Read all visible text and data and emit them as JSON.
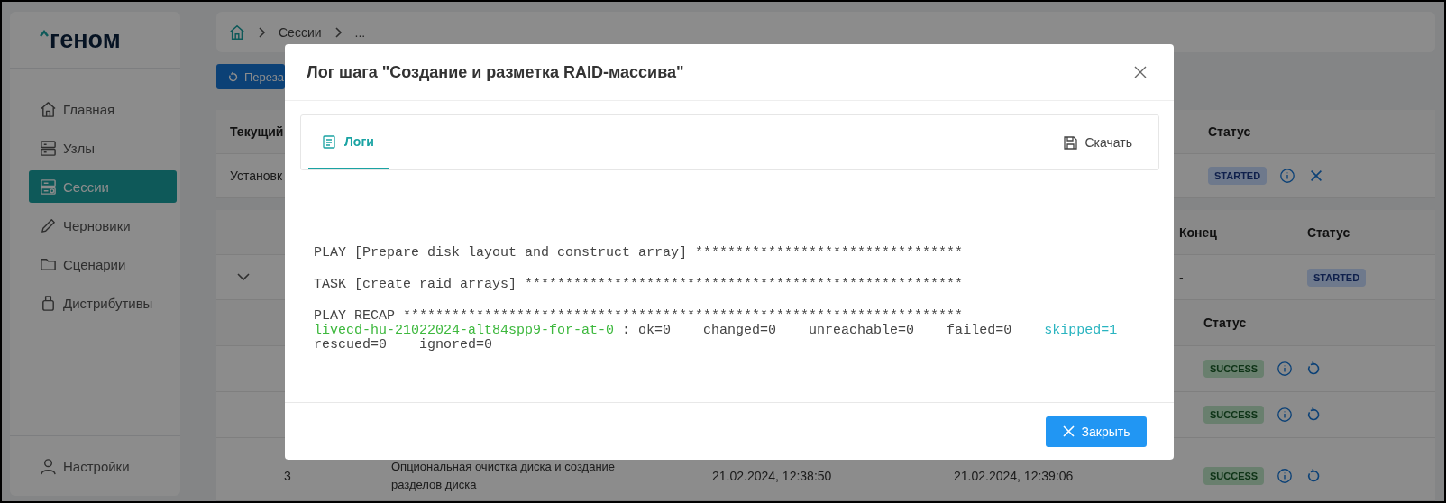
{
  "sidebar": {
    "logo": "геном",
    "items": [
      {
        "label": "Главная",
        "selected": false
      },
      {
        "label": "Узлы",
        "selected": false
      },
      {
        "label": "Сессии",
        "selected": true
      },
      {
        "label": "Черновики",
        "selected": false
      },
      {
        "label": "Сценарии",
        "selected": false
      },
      {
        "label": "Дистрибутивы",
        "selected": false
      }
    ],
    "settings": "Настройки"
  },
  "breadcrumb": [
    "Сессии",
    "..."
  ],
  "restart_button": "Переза",
  "current_table": {
    "columns": [
      "Текущий",
      "Статус"
    ],
    "row": {
      "name": "Установк",
      "status": {
        "label": "STARTED",
        "kind": "started"
      },
      "has_actions": true
    }
  },
  "steps_table": {
    "columns": [
      "Конец",
      "Статус"
    ],
    "row": {
      "end": "-",
      "status": {
        "label": "STARTED",
        "kind": "started"
      },
      "has_actions": false
    },
    "substeps": {
      "columns": [
        "Статус"
      ],
      "rows": [
        {
          "status": {
            "label": "SUCCESS",
            "kind": "success"
          },
          "has_actions": true
        },
        {
          "status": {
            "label": "SUCCESS",
            "kind": "success"
          },
          "has_actions": true
        },
        {
          "number": "3",
          "name": "Опциональная очистка диска и создание разделов диска",
          "start": "21.02.2024, 12:38:50",
          "end": "21.02.2024, 12:39:06",
          "status": {
            "label": "SUCCESS",
            "kind": "success"
          },
          "has_actions": true
        }
      ]
    }
  },
  "modal": {
    "title": "Лог шага \"Создание и разметка RAID-массива\"",
    "tabs": [
      {
        "label": "Логи",
        "selected": true
      }
    ],
    "download": "Скачать",
    "log_blocks": [
      [
        [
          {
            "text": "PLAY [Prepare disk layout and construct array] *********************************",
            "kind": "plain"
          }
        ]
      ],
      [
        [
          {
            "text": "TASK [create raid arrays] ******************************************************",
            "kind": "plain"
          }
        ]
      ],
      [
        [
          {
            "text": "PLAY RECAP *********************************************************************",
            "kind": "plain"
          }
        ],
        [
          {
            "text": "livecd-hu-21022024-alt84spp9-for-at-0",
            "kind": "host"
          },
          {
            "text": " : ok=0    changed=0    unreachable=0    failed=0    ",
            "kind": "plain"
          },
          {
            "text": "skipped=1",
            "kind": "skipped"
          }
        ],
        [
          {
            "text": "rescued=0    ignored=0",
            "kind": "plain"
          }
        ]
      ]
    ],
    "close_button": "Закрыть"
  }
}
